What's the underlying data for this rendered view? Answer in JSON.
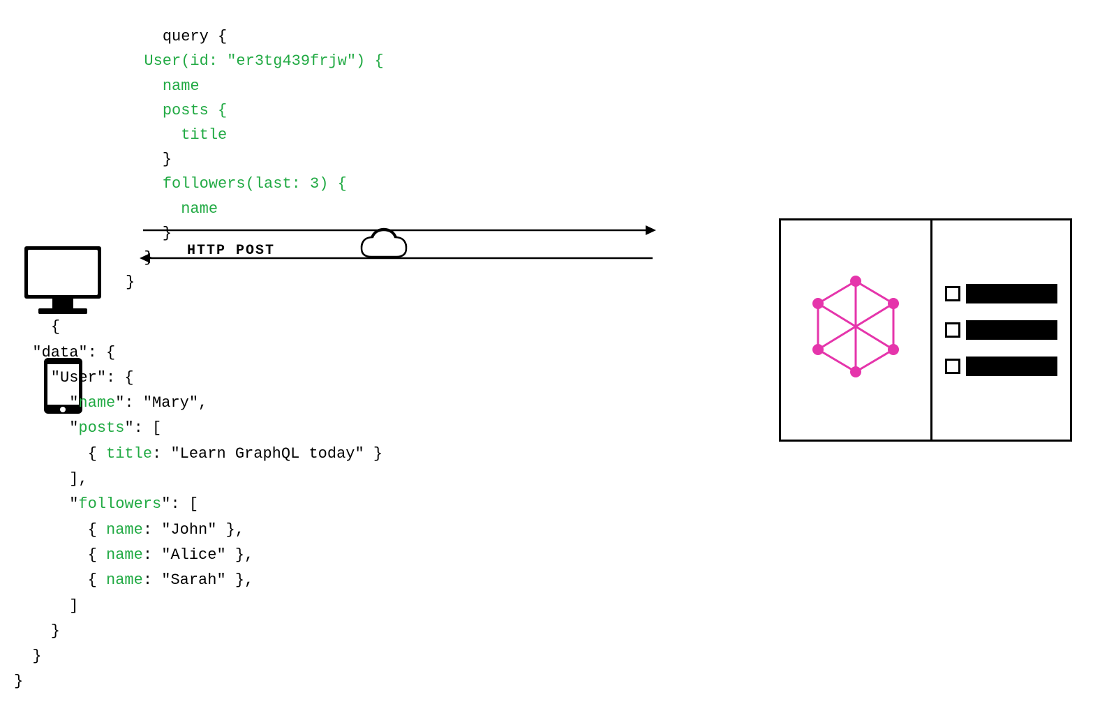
{
  "query": {
    "lines": [
      {
        "text": "query {",
        "color": "black"
      },
      {
        "text": "  User(id: \"er3tg439frjw\") {",
        "color": "green"
      },
      {
        "text": "    name",
        "color": "green"
      },
      {
        "text": "    posts {",
        "color": "green"
      },
      {
        "text": "      title",
        "color": "green"
      },
      {
        "text": "    }",
        "color": "black"
      },
      {
        "text": "    followers(last: 3) {",
        "color": "green"
      },
      {
        "text": "      name",
        "color": "green"
      },
      {
        "text": "    }",
        "color": "black"
      },
      {
        "text": "  }",
        "color": "black"
      },
      {
        "text": "}",
        "color": "black"
      }
    ]
  },
  "http": {
    "label": "HTTP POST"
  },
  "response": {
    "lines": [
      {
        "text": "{",
        "color": "black"
      },
      {
        "text": "  \"data\": {",
        "color": "black"
      },
      {
        "text": "    \"User\": {",
        "color": "black"
      },
      {
        "text": "      \"name\": \"Mary\",",
        "color": "black",
        "green_part": "name"
      },
      {
        "text": "      \"posts\": [",
        "color": "black",
        "green_part": "posts"
      },
      {
        "text": "        { title: \"Learn GraphQL today\" }",
        "color": "black",
        "green_part": "title"
      },
      {
        "text": "      ],",
        "color": "black"
      },
      {
        "text": "      \"followers\": [",
        "color": "black",
        "green_part": "followers"
      },
      {
        "text": "        { name: \"John\" },",
        "color": "black",
        "green_part": "name"
      },
      {
        "text": "        { name: \"Alice\" },",
        "color": "black",
        "green_part": "name"
      },
      {
        "text": "        { name: \"Sarah\" },",
        "color": "black",
        "green_part": "name"
      },
      {
        "text": "      ]",
        "color": "black"
      },
      {
        "text": "    }",
        "color": "black"
      },
      {
        "text": "  }",
        "color": "black"
      },
      {
        "text": "}",
        "color": "black"
      }
    ]
  },
  "graphql": {
    "color": "#e535ab"
  }
}
